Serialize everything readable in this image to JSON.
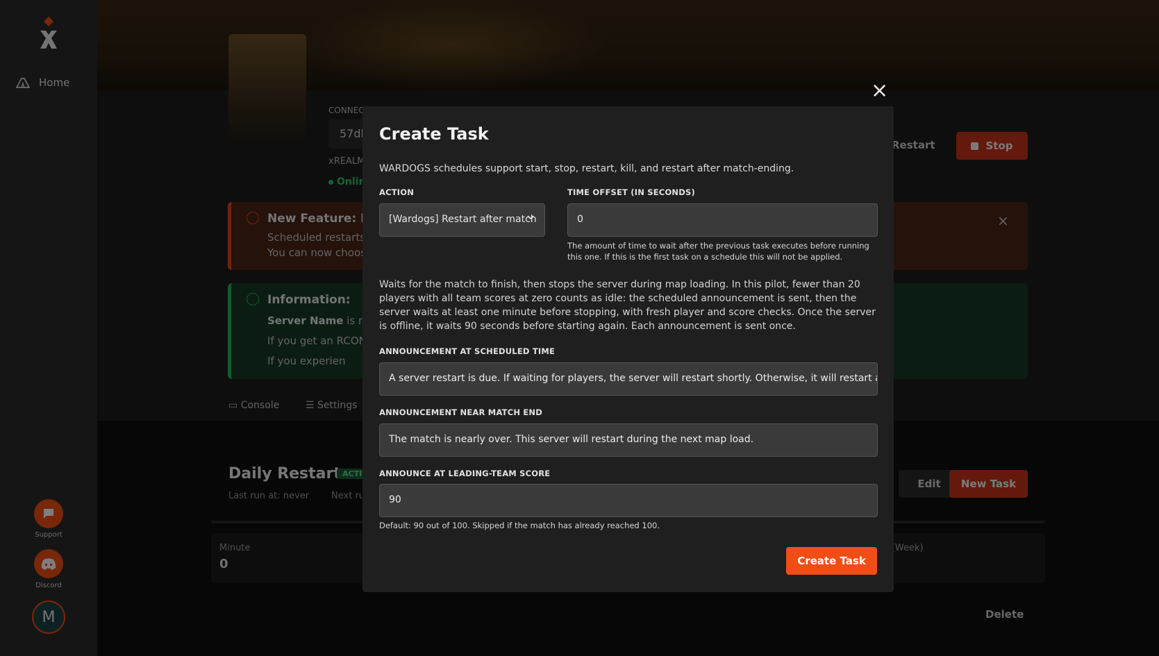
{
  "sidebar": {
    "home_label": "Home",
    "support_label": "Support",
    "discord_label": "Discord",
    "avatar_initial": "M"
  },
  "server": {
    "connect_label": "CONNEC",
    "connect_value": "57dl",
    "name_partial": "xREALM",
    "status": "Onlin",
    "restart_label": "Restart",
    "stop_label": "Stop"
  },
  "alerts": {
    "feature_title": "New Feature: Re",
    "feature_line1": "Scheduled restarts",
    "feature_line2": "You can now choos",
    "info_title": "Information:",
    "info_line1_bold": "Server Name",
    "info_line1_rest": "is no",
    "info_line2": "If you get an RCON",
    "info_line3": "If you experien"
  },
  "tabs": [
    "Console",
    "Settings"
  ],
  "schedule": {
    "title": "Daily Restart",
    "badge": "ACTIV",
    "last_run_label": "Last run at:",
    "last_run_value": "never",
    "next_run_label": "Next ru",
    "edit_label": "Edit",
    "new_task_label": "New Task",
    "cron_minute_label": "Minute",
    "cron_minute_value": "0",
    "cron_dow_label": "Day (Week)",
    "cron_dow_value": "*",
    "delete_label": "Delete"
  },
  "modal": {
    "title": "Create Task",
    "description": "WARDOGS schedules support start, stop, restart, kill, and restart after match-ending.",
    "action_label": "ACTION",
    "action_value": "[Wardogs] Restart after match",
    "offset_label": "TIME OFFSET (IN SECONDS)",
    "offset_value": "0",
    "offset_help": "The amount of time to wait after the previous task executes before running this one. If this is the first task on a schedule this will not be applied.",
    "body": "Waits for the match to finish, then stops the server during map loading. In this pilot, fewer than 20 players with all team scores at zero counts as idle: the scheduled announcement is sent, then the server waits at least one minute before stopping, with fresh player and score checks. Once the server is offline, it waits 90 seconds before starting again. Each announcement is sent once.",
    "ann_sched_label": "ANNOUNCEMENT AT SCHEDULED TIME",
    "ann_sched_value": "A server restart is due. If waiting for players, the server will restart shortly. Otherwise, it will restart after the",
    "ann_end_label": "ANNOUNCEMENT NEAR MATCH END",
    "ann_end_value": "The match is nearly over. This server will restart during the next map load.",
    "ann_score_label": "ANNOUNCE AT LEADING-TEAM SCORE",
    "ann_score_value": "90",
    "ann_score_help": "Default: 90 out of 100. Skipped if the match has already reached 100.",
    "submit_label": "Create Task"
  },
  "colors": {
    "accent": "#f04e15",
    "success": "#2ec56a",
    "danger": "#c9321a"
  }
}
